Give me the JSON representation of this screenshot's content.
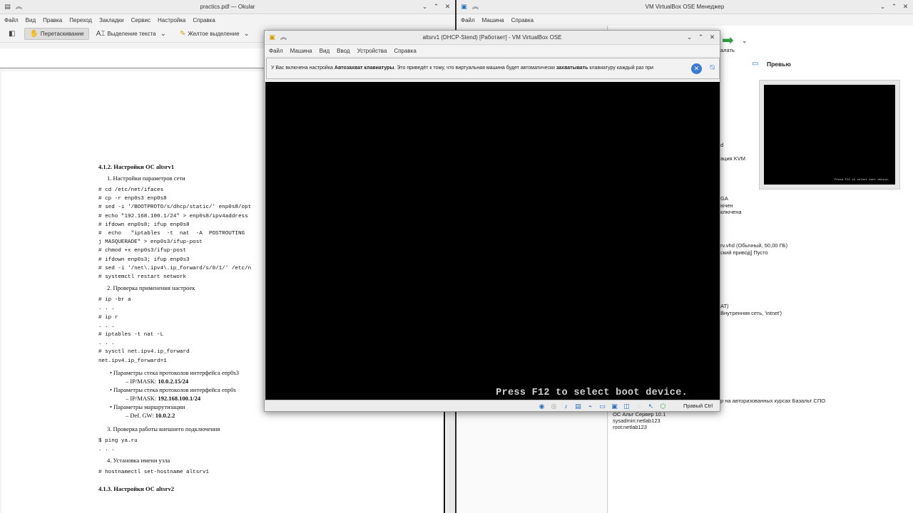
{
  "okular": {
    "title": "practics.pdf — Okular",
    "menu": [
      "Файл",
      "Вид",
      "Правка",
      "Переход",
      "Закладки",
      "Сервис",
      "Настройка",
      "Справка"
    ],
    "toolbar": {
      "drag": "Перетаскивание",
      "text_select": "Выделение текста",
      "highlight": "Желтое выделение"
    },
    "doc": {
      "section_heading": "4.1.2.  Настройки ОС altsrv1",
      "item1": "1.  Настройки параметров сети",
      "code1": [
        "# cd /etc/net/ifaces",
        "# cp -r enp0s3 enp0s8",
        "# sed -i '/BOOTPROTO/s/dhcp/static/' enp0s8/opt",
        "# echo \"192.168.100.1/24\" > enp0s8/ipv4address",
        "# ifdown enp0s8; ifup enp0s8",
        "#  echo   \"iptables  -t  nat  -A  POSTROUTING",
        "j MASQUERADE\" > enp0s3/ifup-post",
        "# chmod +x enp0s3/ifup-post",
        "# ifdown enp0s3; ifup enp0s3",
        "# sed -i '/net\\.ipv4\\.ip_forward/s/0/1/' /etc/n",
        "# systemctl restart network"
      ],
      "item2": "2.  Проверка применения настроек",
      "code2": [
        "# ip -br a",
        ". . .",
        "# ip r",
        ". . .",
        "# iptables -t nat -L",
        ". . .",
        "# sysctl net.ipv4.ip_forward",
        "net.ipv4.ip_forward=1"
      ],
      "b1": "Параметры стека протоколов интерфейса enp0s3",
      "b1_ip_label": "IP/MASK: ",
      "b1_ip": "10.0.2.15/24",
      "b2": "Параметры стека протоколов интерфейса enp0s",
      "b2_ip_label": "IP/MASK: ",
      "b2_ip": "192.168.100.1/24",
      "b3": "Параметры маршрутизации",
      "b3_gw_label": "Def. GW: ",
      "b3_gw": "10.0.2.2",
      "item3": "3.  Проверка работы внешнего подключения",
      "code3": [
        "$ ping ya.ru",
        ". . ."
      ],
      "item4": "4.  Установка имени узла",
      "code4": [
        "# hostnamectl set-hostname altsrv1"
      ],
      "section_heading2": "4.1.3.  Настройки ОС altsrv2"
    }
  },
  "vbm": {
    "title": "VM VirtualBox OSE Менеджер",
    "menu": [
      "Файл",
      "Машина",
      "Справка"
    ],
    "start_label": "алать",
    "preview_title": "Превью",
    "preview_text": "Press F12 to select boot device.",
    "frags": {
      "f1": "d",
      "f2": "ация KVM",
      "f3": "GA",
      "f4": "ючен",
      "f5": "ключена",
      "f6": "rv.vhd (Обычный, 50,00 ГБ)",
      "f7": "ский привод] Пусто",
      "f8": "AT)",
      "f9": "Внутренняя сеть, 'intnet')",
      "f10": "р на авторизованных курсах Базальт СПО",
      "f11": "ОС Альт Сервер 10.1",
      "f12": "sysadmin:netlab123",
      "f13": "root:netlab123"
    }
  },
  "vm": {
    "title": "altsrv1 (DHCP-Stend) [Работает] - VM VirtualBox OSE",
    "menu": [
      "Файл",
      "Машина",
      "Вид",
      "Ввод",
      "Устройства",
      "Справка"
    ],
    "notice_pre": "У Вас включена настройка ",
    "notice_b1": "Автозахват клавиатуры",
    "notice_mid": ". Это приведёт к тому, что виртуальная машина будет автоматически ",
    "notice_b2": "захватывать",
    "notice_post": " клавиатуру каждый раз при",
    "boot_text": "Press F12 to select boot device.",
    "host_key": "Правый Ctrl"
  }
}
